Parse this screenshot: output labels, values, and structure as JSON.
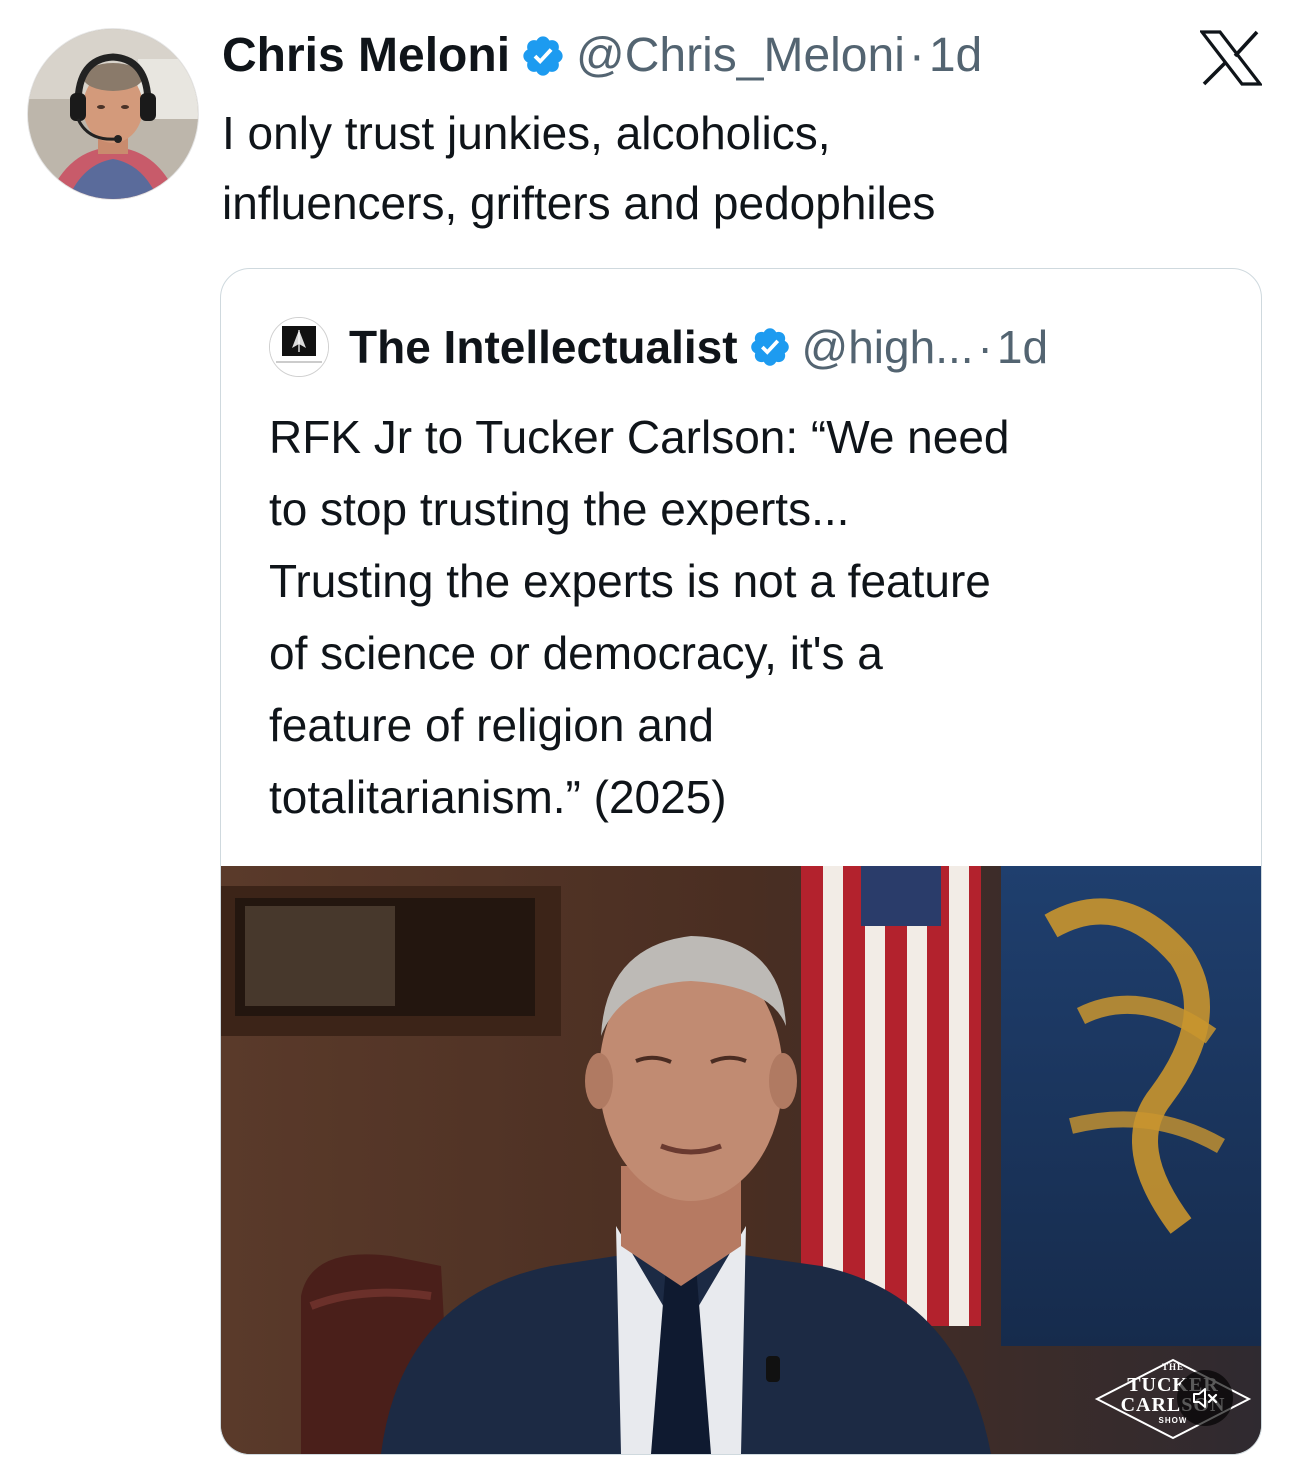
{
  "post": {
    "author_name": "Chris Meloni",
    "handle": "@Chris_Meloni",
    "separator": "·",
    "time": "1d",
    "text_lines": [
      "I only trust junkies, alcoholics,",
      "influencers, grifters and pedophiles"
    ]
  },
  "brand": {
    "x_logo_icon": "x-logo-icon",
    "verified_color": "#1d9bf0"
  },
  "quoted_post": {
    "author_name": "The Intellectualist",
    "avatar_text": "The Intellectualist",
    "handle": "@high...",
    "separator": "·",
    "time": "1d",
    "text_lines": [
      "RFK Jr to Tucker Carlson:  “We need",
      "to stop trusting the experts...",
      "Trusting the experts is not a feature",
      "of science or democracy, it's a",
      "feature of religion and",
      "totalitarianism.” (2025)"
    ],
    "media": {
      "type": "video",
      "muted_icon": "speaker-muted-icon",
      "watermark": {
        "line1": "THE",
        "line2": "TUCKER",
        "line3": "CARLSON",
        "line4": "SHOW"
      }
    }
  }
}
